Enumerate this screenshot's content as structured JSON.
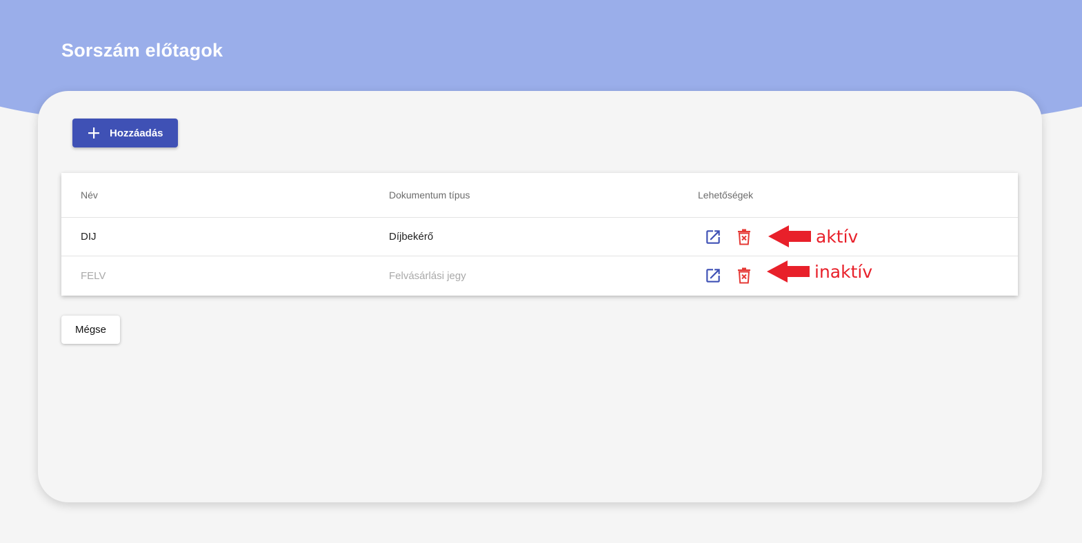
{
  "header": {
    "title": "Sorszám előtagok"
  },
  "toolbar": {
    "add_label": "Hozzáadás"
  },
  "table": {
    "columns": [
      "Név",
      "Dokumentum típus",
      "Lehetőségek"
    ],
    "rows": [
      {
        "name": "DIJ",
        "doc_type": "Díjbekérő",
        "status": "active"
      },
      {
        "name": "FELV",
        "doc_type": "Felvásárlási jegy",
        "status": "inactive"
      }
    ]
  },
  "annotations": {
    "active_label": "aktív",
    "inactive_label": "inaktív"
  },
  "footer": {
    "cancel_label": "Mégse"
  },
  "colors": {
    "header_band": "#9aaeea",
    "primary": "#3f51b5",
    "danger": "#e53935",
    "annotation": "#e8202a",
    "inactive_text": "#a9a9a9"
  },
  "icons": {
    "add": "plus-icon",
    "edit": "open-in-new-icon",
    "delete": "trash-x-icon",
    "annotation": "arrow-left-icon"
  }
}
